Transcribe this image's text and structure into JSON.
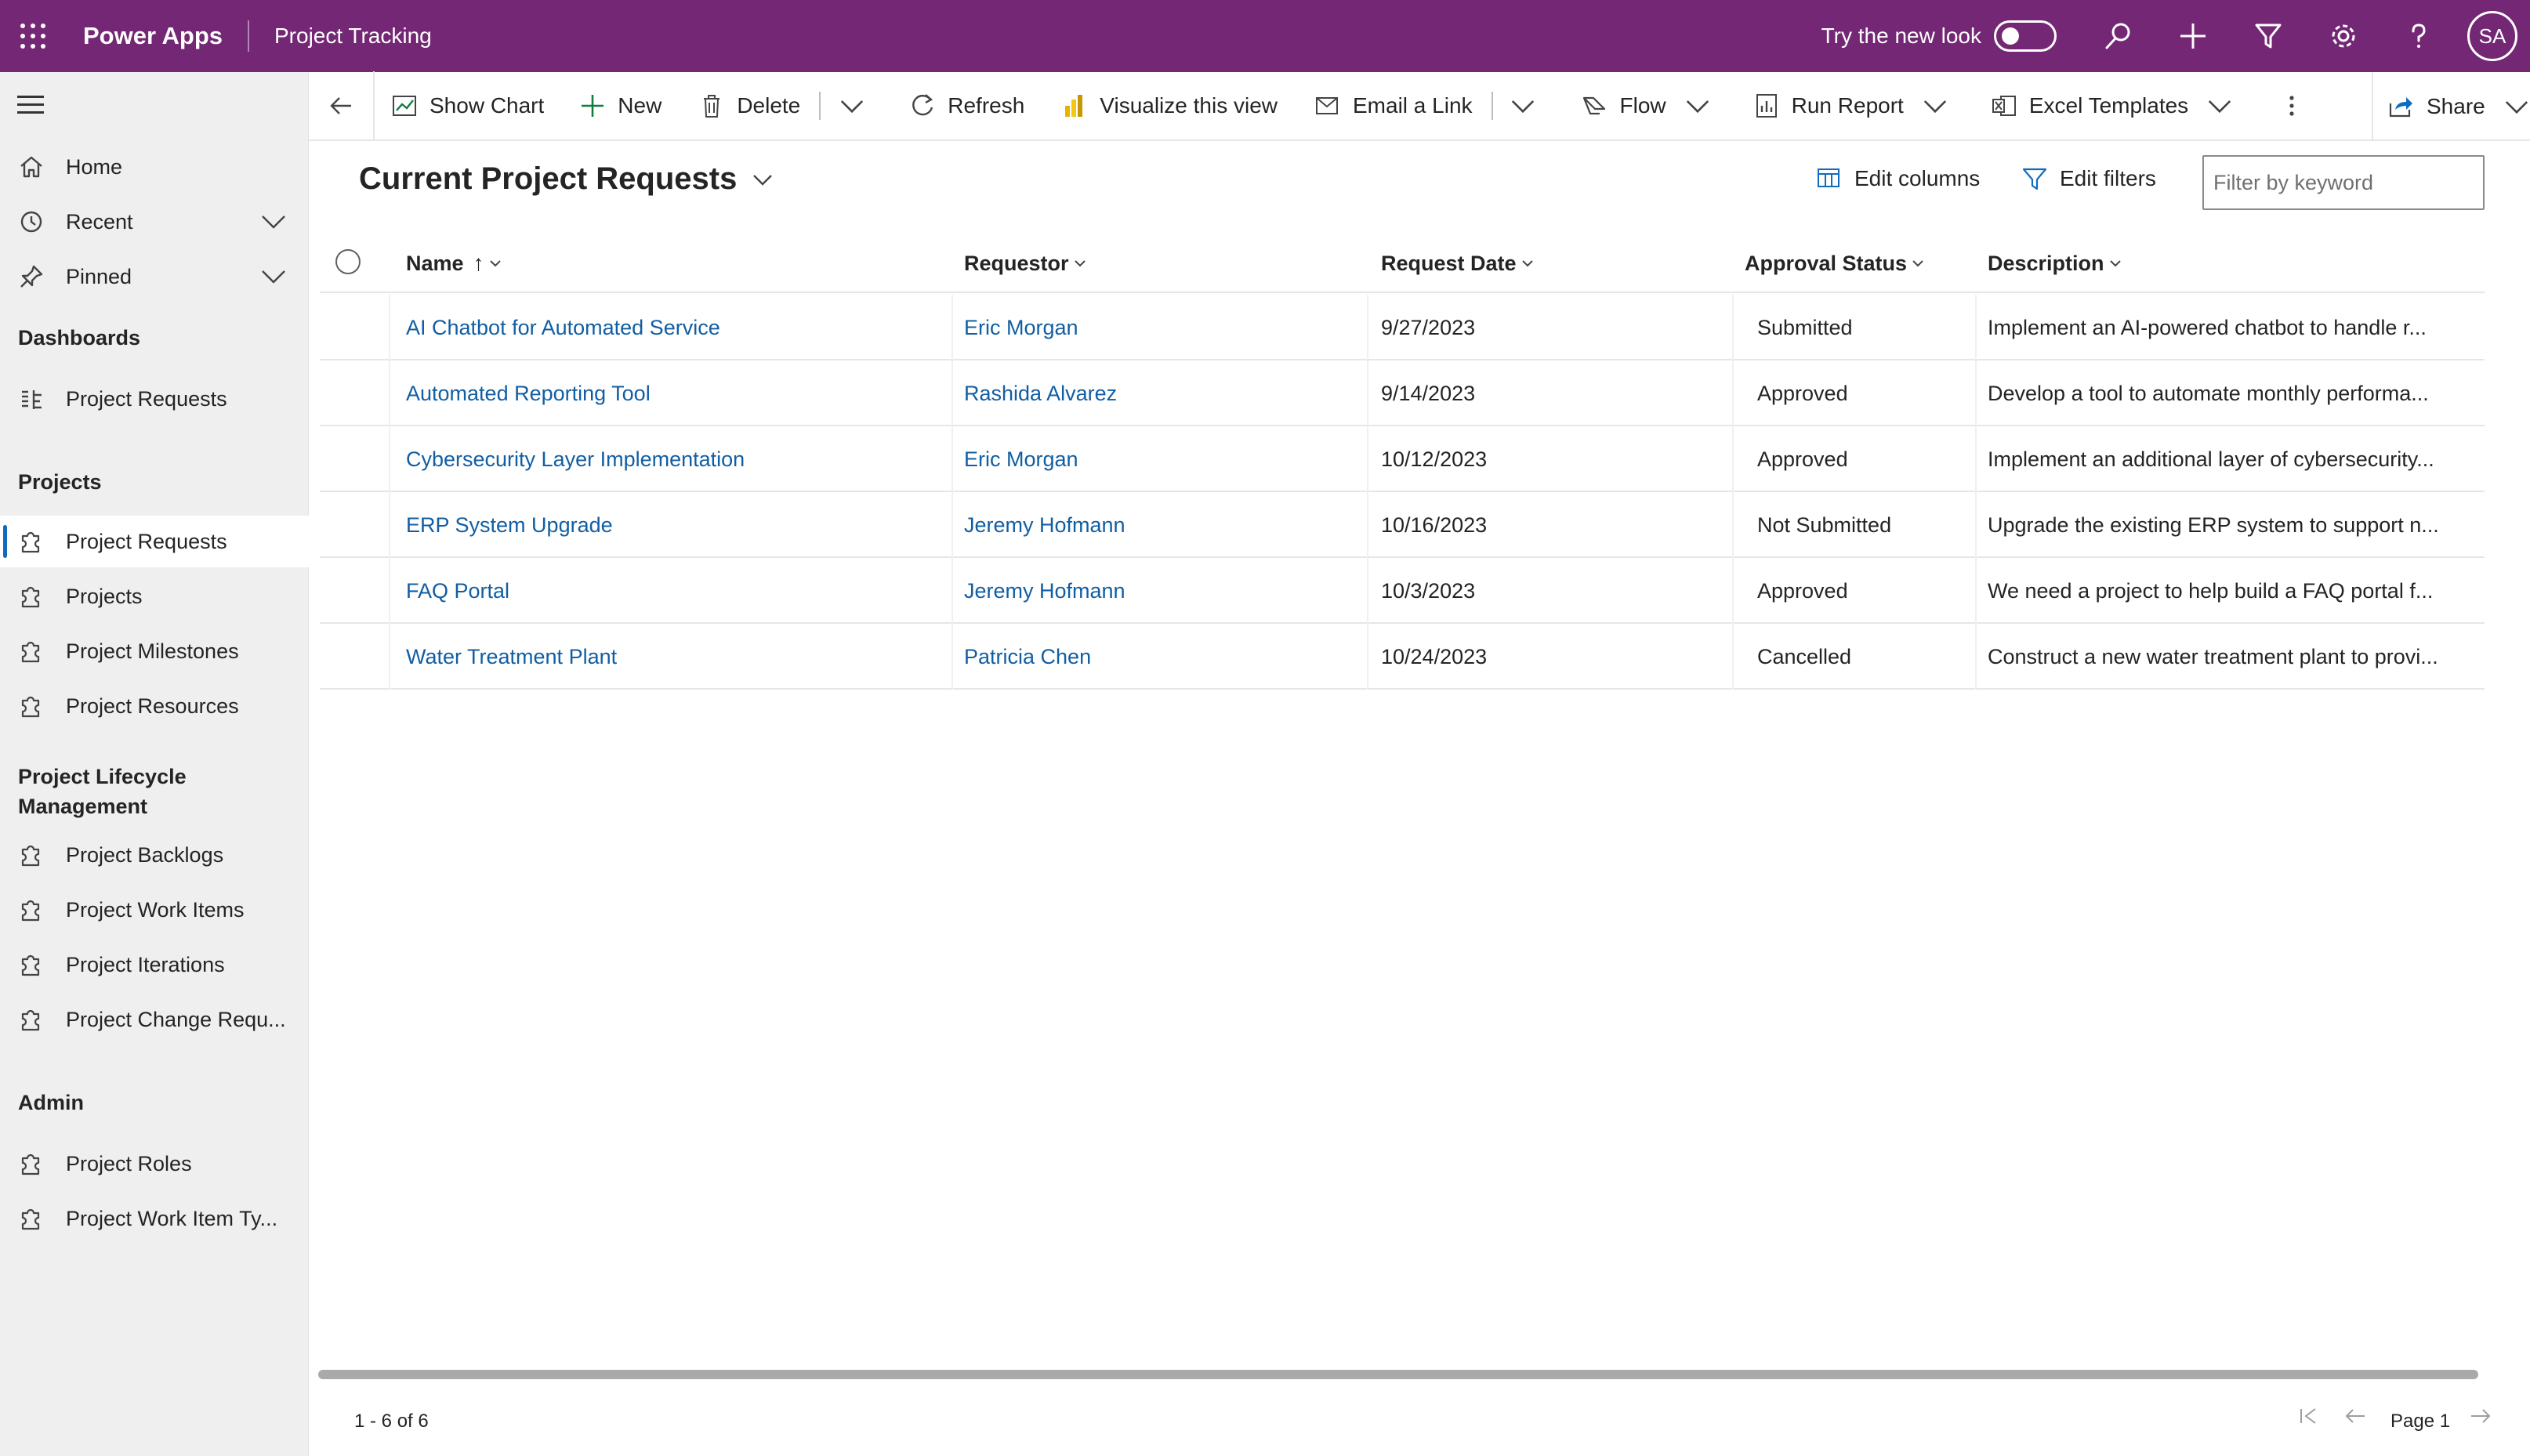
{
  "topbar": {
    "app_name": "Power Apps",
    "app_title": "Project Tracking",
    "try_new_look": "Try the new look",
    "avatar_initials": "SA",
    "bg_color": "#742774"
  },
  "sidebar": {
    "top_items": [
      {
        "label": "Home",
        "icon": "home-icon"
      },
      {
        "label": "Recent",
        "icon": "clock-icon"
      },
      {
        "label": "Pinned",
        "icon": "pin-icon"
      }
    ],
    "groups": {
      "dashboards": "Dashboards",
      "projects": "Projects",
      "lifecycle": "Project Lifecycle Management",
      "admin": "Admin"
    },
    "dashboard_items": [
      {
        "label": "Project Requests",
        "icon": "dashboard-icon"
      }
    ],
    "project_items": [
      {
        "label": "Project Requests",
        "icon": "puzzle-icon"
      },
      {
        "label": "Projects",
        "icon": "puzzle-icon"
      },
      {
        "label": "Project Milestones",
        "icon": "puzzle-icon"
      },
      {
        "label": "Project Resources",
        "icon": "puzzle-icon"
      }
    ],
    "lifecycle_items": [
      {
        "label": "Project Backlogs",
        "icon": "puzzle-icon"
      },
      {
        "label": "Project Work Items",
        "icon": "puzzle-icon"
      },
      {
        "label": "Project Iterations",
        "icon": "puzzle-icon"
      },
      {
        "label": "Project Change Requ...",
        "icon": "puzzle-icon"
      }
    ],
    "admin_items": [
      {
        "label": "Project Roles",
        "icon": "puzzle-icon"
      },
      {
        "label": "Project Work Item Ty...",
        "icon": "puzzle-icon"
      }
    ]
  },
  "commandbar": {
    "show_chart": "Show Chart",
    "new": "New",
    "delete": "Delete",
    "refresh": "Refresh",
    "visualize": "Visualize this view",
    "email_link": "Email a Link",
    "flow": "Flow",
    "run_report": "Run Report",
    "excel_templates": "Excel Templates",
    "share": "Share"
  },
  "view": {
    "title": "Current Project Requests",
    "edit_columns": "Edit columns",
    "edit_filters": "Edit filters",
    "filter_placeholder": "Filter by keyword"
  },
  "grid": {
    "columns": [
      "Name",
      "Requestor",
      "Request Date",
      "Approval Status",
      "Description"
    ],
    "rows": [
      [
        "AI Chatbot for Automated Service",
        "Eric Morgan",
        "9/27/2023",
        "Submitted",
        "Implement an AI-powered chatbot to handle r..."
      ],
      [
        "Automated Reporting Tool",
        "Rashida Alvarez",
        "9/14/2023",
        "Approved",
        "Develop a tool to automate monthly performa..."
      ],
      [
        "Cybersecurity Layer Implementation",
        "Eric Morgan",
        "10/12/2023",
        "Approved",
        "Implement an additional layer of cybersecurity..."
      ],
      [
        "ERP System Upgrade",
        "Jeremy Hofmann",
        "10/16/2023",
        "Not Submitted",
        "Upgrade the existing ERP system to support n..."
      ],
      [
        "FAQ Portal",
        "Jeremy Hofmann",
        "10/3/2023",
        "Approved",
        "We need a project to help build a FAQ portal f..."
      ],
      [
        "Water Treatment Plant",
        "Patricia Chen",
        "10/24/2023",
        "Cancelled",
        "Construct a new water treatment plant to provi..."
      ]
    ]
  },
  "footer": {
    "count": "1 - 6 of 6",
    "page": "Page 1"
  }
}
